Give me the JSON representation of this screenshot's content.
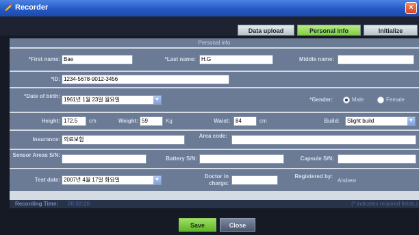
{
  "window": {
    "title": "Recorder",
    "close_symbol": "×"
  },
  "tabs": [
    {
      "label": "Data upload"
    },
    {
      "label": "Personal info"
    },
    {
      "label": "Initialize"
    }
  ],
  "panel": {
    "header": "Personal info"
  },
  "fields": {
    "first_name": {
      "label": "*First name:",
      "value": "Bae"
    },
    "last_name": {
      "label": "*Last name:",
      "value": "H.G"
    },
    "middle_name": {
      "label": "Middle name:",
      "value": ""
    },
    "id": {
      "label": "*ID:",
      "value": "1234-5678-9012-3456"
    },
    "dob": {
      "label": "*Date of birth:",
      "value": "1961년 1월 23일 월요일"
    },
    "gender": {
      "label": "*Gender:",
      "options": [
        "Male",
        "Female"
      ],
      "selected": "Male"
    },
    "height": {
      "label": "Height:",
      "value": "172.5",
      "unit": "cm"
    },
    "weight": {
      "label": "Weight:",
      "value": "59",
      "unit": "Kg"
    },
    "waist": {
      "label": "Waist:",
      "value": "84",
      "unit": "cm"
    },
    "build": {
      "label": "Build:",
      "value": "Slight build"
    },
    "insurance": {
      "label": "Insurance:",
      "value": "의료보험"
    },
    "area_code": {
      "label": "Area code:",
      "value": ""
    },
    "sensor_area": {
      "label": "Sensor Areas S/N:",
      "value": ""
    },
    "battery": {
      "label": "Battery S/N:",
      "value": ""
    },
    "capsule": {
      "label": "Capsule S/N:",
      "value": ""
    },
    "test_date": {
      "label": "Test date:",
      "value": "2007년 4월 17일 화요일"
    },
    "doctor": {
      "label": "Doctor in charge:",
      "value": ""
    },
    "registered_by": {
      "label": "Registered by:",
      "value": "Andrew"
    }
  },
  "footer": {
    "recording_label": "Recording Time:",
    "recording_time": "00:02:20",
    "required_note": "(* indicates required fields.)"
  },
  "buttons": {
    "save": "Save",
    "close": "Close"
  },
  "colors": {
    "title_bar": "#2559c4",
    "active_tab": "#7fcf46",
    "row_bg": "#6b7b96",
    "save_button": "#61b62a"
  }
}
